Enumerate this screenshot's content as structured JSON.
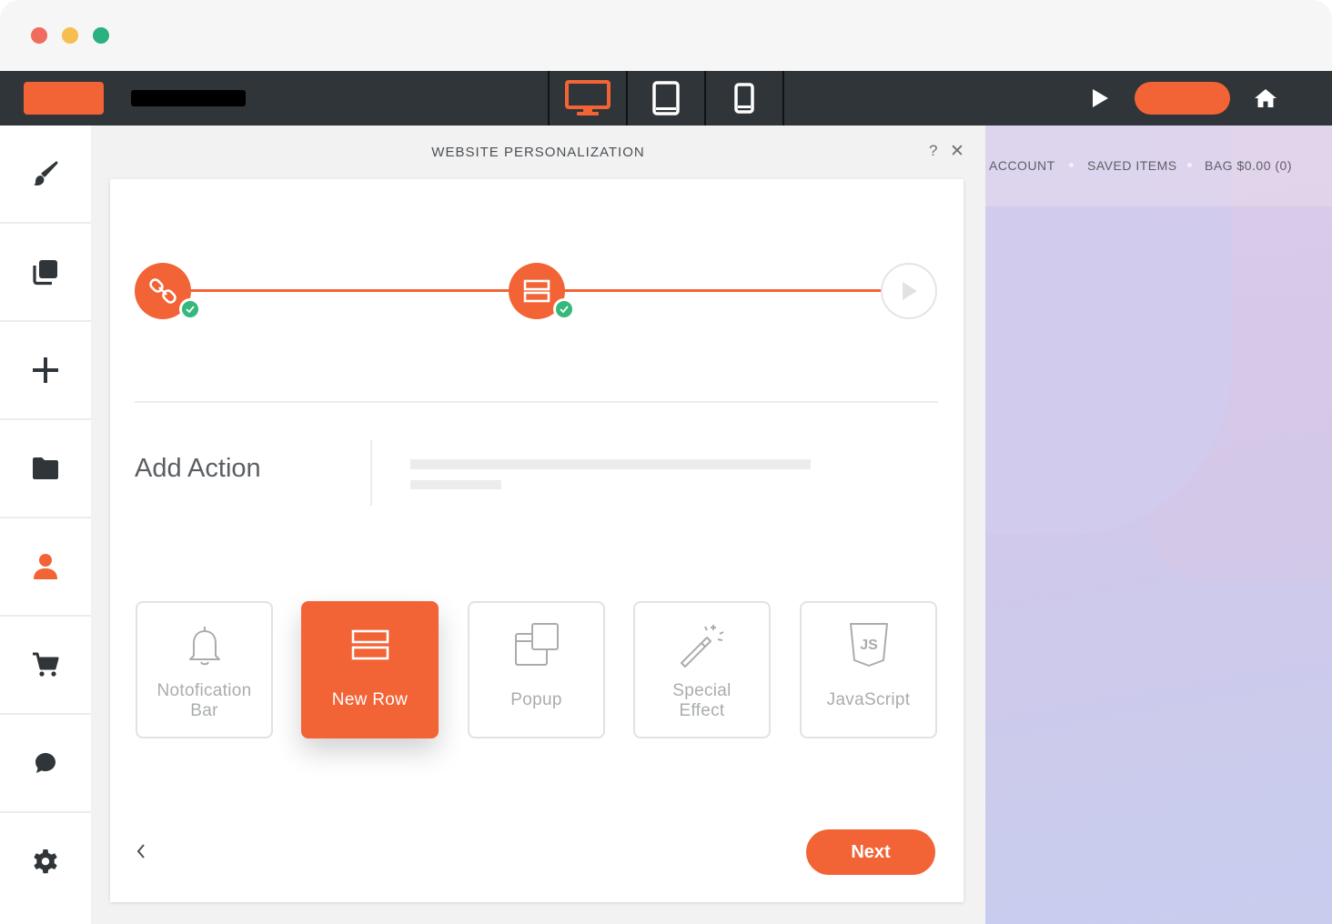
{
  "window": {
    "controls": [
      "close",
      "minimize",
      "maximize"
    ]
  },
  "toolbar": {
    "device_buttons": [
      {
        "name": "desktop-icon",
        "active": true,
        "color": "#f26336"
      },
      {
        "name": "tablet-icon",
        "active": false,
        "color": "#ffffff"
      },
      {
        "name": "mobile-icon",
        "active": false,
        "color": "#ffffff"
      }
    ],
    "accent": "#f26336"
  },
  "sidebar": {
    "items": [
      {
        "icon": "paintbrush-icon"
      },
      {
        "icon": "layers-icon"
      },
      {
        "icon": "plus-icon"
      },
      {
        "icon": "folder-icon"
      },
      {
        "icon": "person-icon",
        "active": true
      },
      {
        "icon": "cart-icon"
      },
      {
        "icon": "chat-icon"
      },
      {
        "icon": "gear-icon"
      }
    ]
  },
  "panel": {
    "title": "WEBSITE PERSONALIZATION",
    "help": "?",
    "close": "✕",
    "stepper": {
      "steps": [
        {
          "icon": "link-icon",
          "status": "done"
        },
        {
          "icon": "rows-icon",
          "status": "done"
        },
        {
          "icon": "play-icon",
          "status": "pending"
        }
      ]
    },
    "section_title": "Add Action",
    "actions": [
      {
        "label_line1": "Notofication",
        "label_line2": "Bar",
        "icon": "bell-icon",
        "selected": false
      },
      {
        "label_line1": "New Row",
        "label_line2": "",
        "icon": "rows-icon",
        "selected": true
      },
      {
        "label_line1": "Popup",
        "label_line2": "",
        "icon": "popup-icon",
        "selected": false
      },
      {
        "label_line1": "Special",
        "label_line2": "Effect",
        "icon": "magic-wand-icon",
        "selected": false
      },
      {
        "label_line1": "JavaScript",
        "label_line2": "",
        "icon": "js-icon",
        "selected": false
      }
    ],
    "back_label": "‹",
    "next_label": "Next"
  },
  "preview": {
    "nav": {
      "links": [
        "ACCOUNT",
        "SAVED ITEMS",
        "BAG $0.00 (0)"
      ]
    }
  },
  "colors": {
    "accent": "#f26336",
    "success": "#34b87c",
    "toolbar_bg": "#2f3538"
  }
}
